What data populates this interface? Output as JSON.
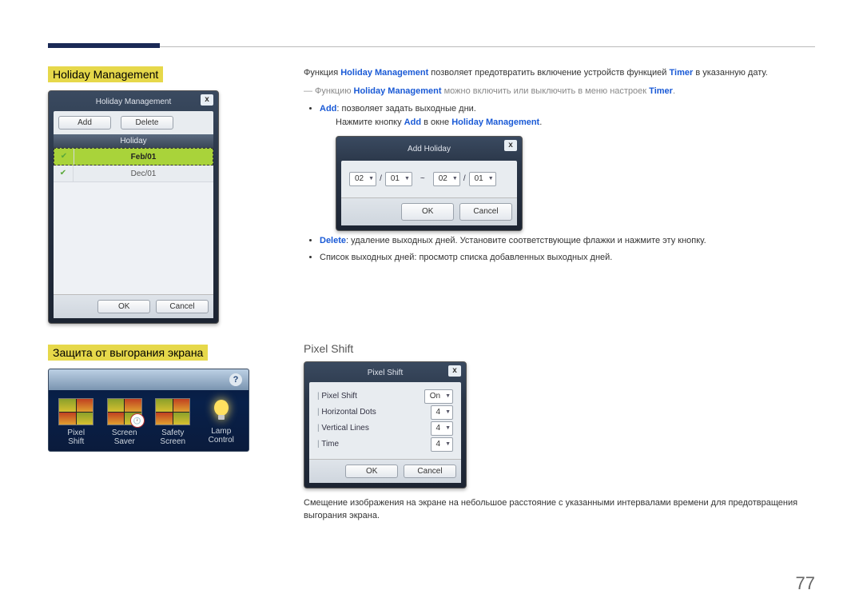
{
  "sections": {
    "holiday_mgmt": "Holiday Management",
    "screen_protect": "Защита от выгорания экрана",
    "pixel_shift": "Pixel Shift"
  },
  "holiday_dialog": {
    "title": "Holiday Management",
    "add_btn": "Add",
    "delete_btn": "Delete",
    "col_header": "Holiday",
    "rows": [
      "Feb/01",
      "Dec/01"
    ],
    "ok": "OK",
    "cancel": "Cancel"
  },
  "add_holiday_dialog": {
    "title": "Add Holiday",
    "from_m": "02",
    "from_d": "01",
    "to_m": "02",
    "to_d": "01",
    "sep": "~",
    "slash": "/",
    "ok": "OK",
    "cancel": "Cancel"
  },
  "pixel_shift_dialog": {
    "title": "Pixel Shift",
    "rows": {
      "pixel_shift": {
        "label": "Pixel Shift",
        "value": "On"
      },
      "hdots": {
        "label": "Horizontal Dots",
        "value": "4"
      },
      "vlines": {
        "label": "Vertical Lines",
        "value": "4"
      },
      "time": {
        "label": "Time",
        "value": "4"
      }
    },
    "ok": "OK",
    "cancel": "Cancel"
  },
  "toolbar": {
    "help": "?",
    "items": {
      "pixel_shift": "Pixel\nShift",
      "screen_saver": "Screen\nSaver",
      "safety_screen": "Safety\nScreen",
      "lamp_control": "Lamp\nControl"
    }
  },
  "body": {
    "p1_a": "Функция ",
    "p1_b": "Holiday Management",
    "p1_c": " позволяет предотвратить включение устройств функцией ",
    "p1_d": "Timer",
    "p1_e": " в указанную дату.",
    "note_a": "Функцию ",
    "note_b": "Holiday Management",
    "note_c": " можно включить или выключить в меню настроек ",
    "note_d": "Timer",
    "note_e": ".",
    "li_add_a": "Add",
    "li_add_b": ": позволяет задать выходные дни.",
    "li_add_sub_a": "Нажмите кнопку ",
    "li_add_sub_b": "Add",
    "li_add_sub_c": " в окне ",
    "li_add_sub_d": "Holiday Management",
    "li_add_sub_e": ".",
    "li_del_a": "Delete",
    "li_del_b": ": удаление выходных дней. Установите соответствующие флажки и нажмите эту кнопку.",
    "li_list": "Список выходных дней: просмотр списка добавленных выходных дней.",
    "ps_desc": "Смещение изображения на экране на небольшое расстояние с указанными интервалами времени для предотвращения выгорания экрана."
  },
  "page_number": "77"
}
